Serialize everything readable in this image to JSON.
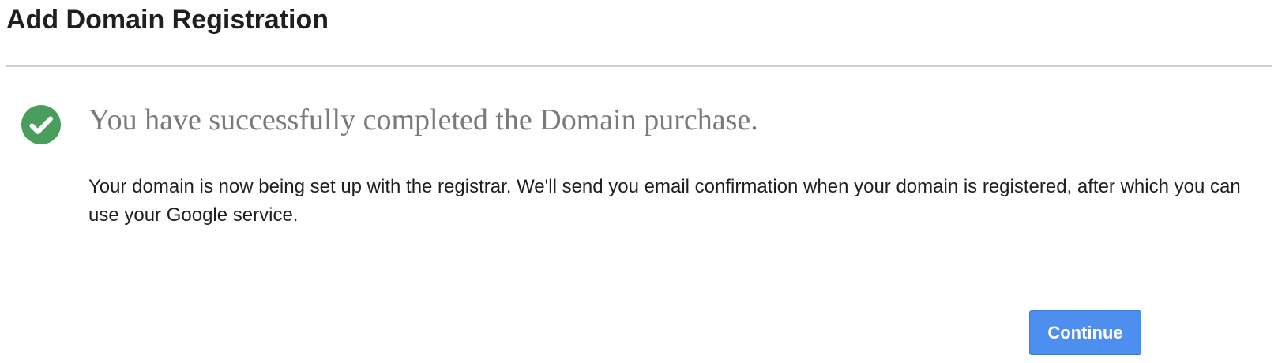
{
  "page": {
    "title": "Add Domain Registration"
  },
  "confirmation": {
    "icon": "checkmark-circle-icon",
    "icon_color": "#4a9e5c",
    "heading": "You have successfully completed the Domain purchase.",
    "message": "Your domain is now being set up with the registrar. We'll send you email confirmation when your domain is registered, after which you can use your Google service."
  },
  "actions": {
    "continue_label": "Continue",
    "accent_color": "#4d8fee"
  }
}
